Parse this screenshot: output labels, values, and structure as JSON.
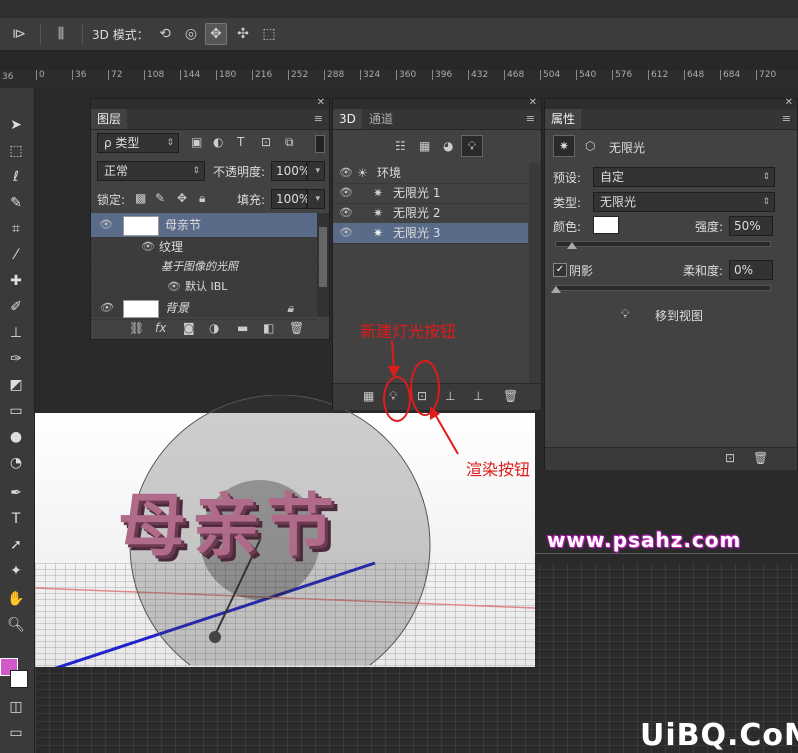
{
  "options_bar": {
    "mode_label": "3D 模式："
  },
  "ruler": {
    "corner": "36",
    "ticks": [
      "0",
      "36",
      "72",
      "108",
      "144",
      "180",
      "216",
      "252",
      "288",
      "324",
      "360",
      "396",
      "432",
      "468",
      "504",
      "540",
      "576",
      "612",
      "648",
      "684",
      "720"
    ]
  },
  "layers_panel": {
    "tab": "图层",
    "filter_kind": "ρ 类型",
    "blend_mode": "正常",
    "opacity_label": "不透明度:",
    "opacity_value": "100%",
    "lock_label": "锁定:",
    "fill_label": "填充:",
    "fill_value": "100%",
    "layers": [
      {
        "name": "母亲节"
      },
      {
        "name": "纹理"
      },
      {
        "name": "基于图像的光照"
      },
      {
        "name": "默认 IBL"
      },
      {
        "name": "背景"
      }
    ]
  },
  "threed_panel": {
    "tabs": [
      "3D",
      "通道"
    ],
    "items": [
      {
        "name": "环境"
      },
      {
        "name": "无限光 1"
      },
      {
        "name": "无限光 2"
      },
      {
        "name": "无限光 3"
      }
    ]
  },
  "properties_panel": {
    "tab": "属性",
    "header_title": "无限光",
    "preset_label": "预设:",
    "preset_value": "自定",
    "type_label": "类型:",
    "type_value": "无限光",
    "color_label": "颜色:",
    "intensity_label": "强度:",
    "intensity_value": "50%",
    "shadow_label": "阴影",
    "softness_label": "柔和度:",
    "softness_value": "0%",
    "move_to_view": "移到视图"
  },
  "annotations": {
    "new_light": "新建灯光按钮",
    "render": "渲染按钮"
  },
  "watermarks": {
    "psahz": "www.psahz.com",
    "uibq": "UiBQ.CoM"
  },
  "canvas_text": {
    "title": "母亲节"
  },
  "colors": {
    "annotation_red": "#e01b1b",
    "foreground_swatch": "#d05ac8",
    "text_3d_pink": "#b06a8a",
    "selection_blue": "#5a6b8a"
  }
}
